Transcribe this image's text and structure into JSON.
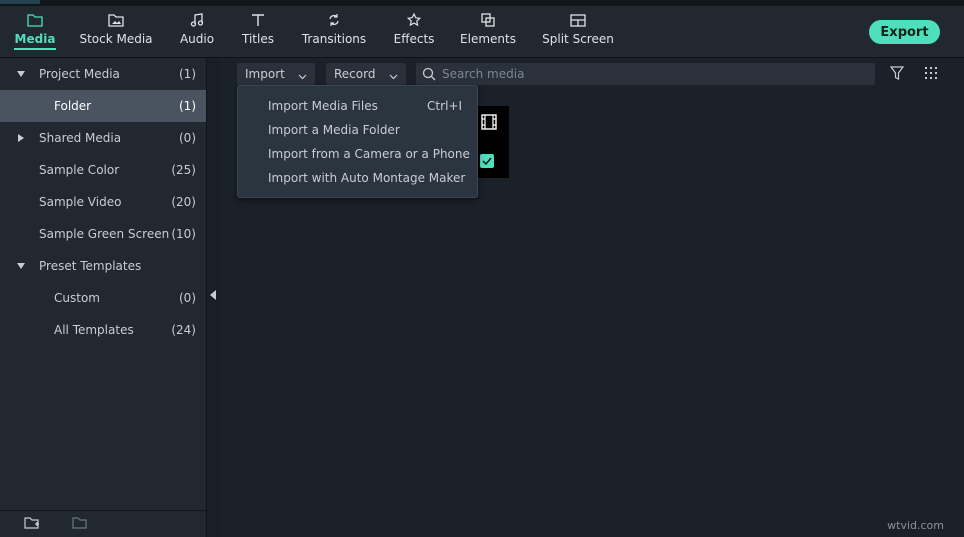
{
  "toolbar": {
    "tabs": [
      {
        "label": "Media",
        "icon": "folder-icon"
      },
      {
        "label": "Stock Media",
        "icon": "stock-media-icon"
      },
      {
        "label": "Audio",
        "icon": "music-note-icon"
      },
      {
        "label": "Titles",
        "icon": "text-t-icon"
      },
      {
        "label": "Transitions",
        "icon": "transitions-icon"
      },
      {
        "label": "Effects",
        "icon": "effects-icon"
      },
      {
        "label": "Elements",
        "icon": "elements-icon"
      },
      {
        "label": "Split Screen",
        "icon": "split-screen-icon"
      }
    ],
    "export_label": "Export"
  },
  "sidebar": {
    "items": [
      {
        "label": "Project Media",
        "count": "(1)"
      },
      {
        "label": "Folder",
        "count": "(1)"
      },
      {
        "label": "Shared Media",
        "count": "(0)"
      },
      {
        "label": "Sample Color",
        "count": "(25)"
      },
      {
        "label": "Sample Video",
        "count": "(20)"
      },
      {
        "label": "Sample Green Screen",
        "count": "(10)"
      },
      {
        "label": "Preset Templates",
        "count": ""
      },
      {
        "label": "Custom",
        "count": "(0)"
      },
      {
        "label": "All Templates",
        "count": "(24)"
      }
    ]
  },
  "main": {
    "import_label": "Import",
    "record_label": "Record",
    "search_placeholder": "Search media"
  },
  "import_menu": {
    "items": [
      {
        "label": "Import Media Files",
        "shortcut": "Ctrl+I"
      },
      {
        "label": "Import a Media Folder",
        "shortcut": ""
      },
      {
        "label": "Import from a Camera or a Phone",
        "shortcut": ""
      },
      {
        "label": "Import with Auto Montage Maker",
        "shortcut": ""
      }
    ]
  },
  "watermark": "wtvid.com",
  "colors": {
    "accent": "#4ee0bc",
    "panel": "#222830",
    "background": "#1b2128",
    "selected_row": "#4a5460"
  }
}
